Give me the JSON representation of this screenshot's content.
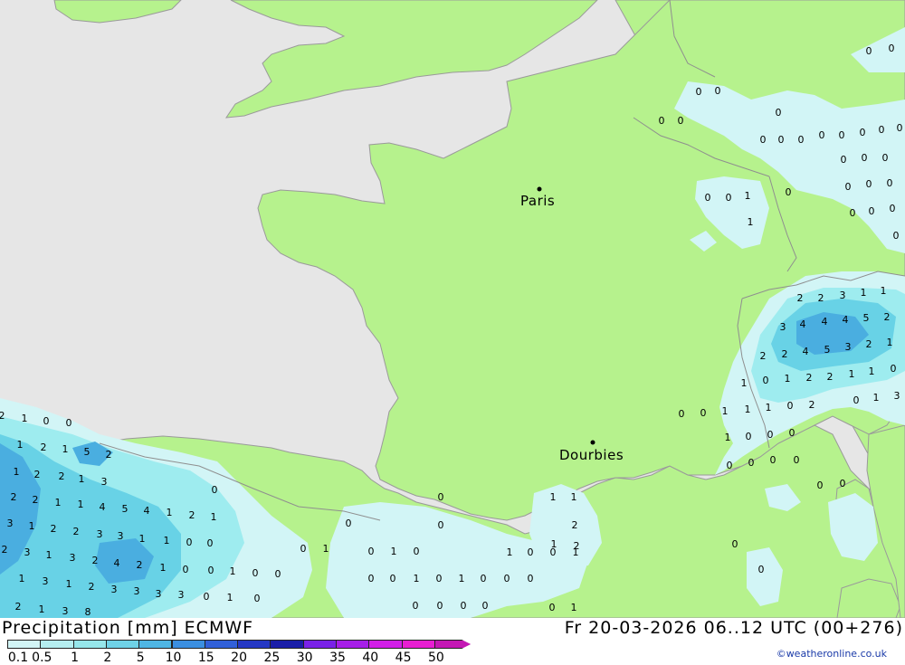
{
  "map": {
    "colors": {
      "sea": "#e6e6e6",
      "land": "#b6f28d",
      "border": "#9a9a9a",
      "precip_light": "#d2f5f6",
      "precip_mid": "#9eecef",
      "precip_heavy": "#68d2e6",
      "precip_strong": "#4aaee0"
    },
    "cities": [
      {
        "name": "Paris"
      },
      {
        "name": "Dourbies"
      }
    ],
    "values": [
      "0",
      "0",
      "0",
      "0",
      "0",
      "0",
      "0",
      "0",
      "0",
      "0",
      "0",
      "0",
      "0",
      "0",
      "0",
      "0",
      "0",
      "0",
      "0",
      "0",
      "0",
      "0",
      "0",
      "0",
      "0",
      "0",
      "0",
      "1",
      "0",
      "2",
      "2",
      "3",
      "1",
      "1",
      "3",
      "4",
      "4",
      "4",
      "5",
      "2",
      "2",
      "2",
      "4",
      "5",
      "3",
      "2",
      "1",
      "1",
      "0",
      "1",
      "2",
      "2",
      "1",
      "1",
      "0",
      "1",
      "0",
      "0",
      "1",
      "1",
      "1",
      "0",
      "2",
      "0",
      "1",
      "3",
      "1",
      "0",
      "0",
      "0",
      "0",
      "0",
      "1",
      "1",
      "2",
      "0",
      "0",
      "0",
      "0",
      "0",
      "0",
      "1",
      "0",
      "0",
      "1",
      "2",
      "1",
      "0",
      "0",
      "5",
      "2",
      "1",
      "2",
      "1",
      "1",
      "2",
      "2",
      "1",
      "3",
      "0",
      "2",
      "2",
      "1",
      "1",
      "4",
      "5",
      "4",
      "1",
      "2",
      "1",
      "3",
      "1",
      "2",
      "2",
      "3",
      "3",
      "1",
      "1",
      "0",
      "0",
      "2",
      "3",
      "1",
      "3",
      "2",
      "4",
      "2",
      "1",
      "0",
      "0",
      "1",
      "0",
      "0",
      "1",
      "3",
      "1",
      "2",
      "3",
      "3",
      "3",
      "3",
      "0",
      "1",
      "0",
      "2",
      "1",
      "3",
      "8",
      "0",
      "1",
      "0",
      "1",
      "0",
      "0",
      "0",
      "0",
      "1",
      "0",
      "1",
      "0",
      "0",
      "0",
      "0",
      "0",
      "0",
      "0",
      "0",
      "1",
      "1",
      "2",
      "0",
      "0"
    ]
  },
  "footer": {
    "title": "Precipitation [mm] ECMWF",
    "valid": "Fr 20-03-2026 06..12 UTC (00+276)",
    "credit": "©weatheronline.co.uk"
  },
  "legend": {
    "labels": [
      "0.1",
      "0.5",
      "1",
      "2",
      "5",
      "10",
      "15",
      "20",
      "25",
      "30",
      "35",
      "40",
      "45",
      "50"
    ],
    "colors": [
      "#d2f5f6",
      "#b5eef0",
      "#96e6ea",
      "#6fd2e6",
      "#4fb6e4",
      "#3b8fe0",
      "#3160d8",
      "#2538c4",
      "#1a1ea8",
      "#7a22e8",
      "#a61ee8",
      "#d21ee8",
      "#e81ed2",
      "#c418b4"
    ]
  }
}
